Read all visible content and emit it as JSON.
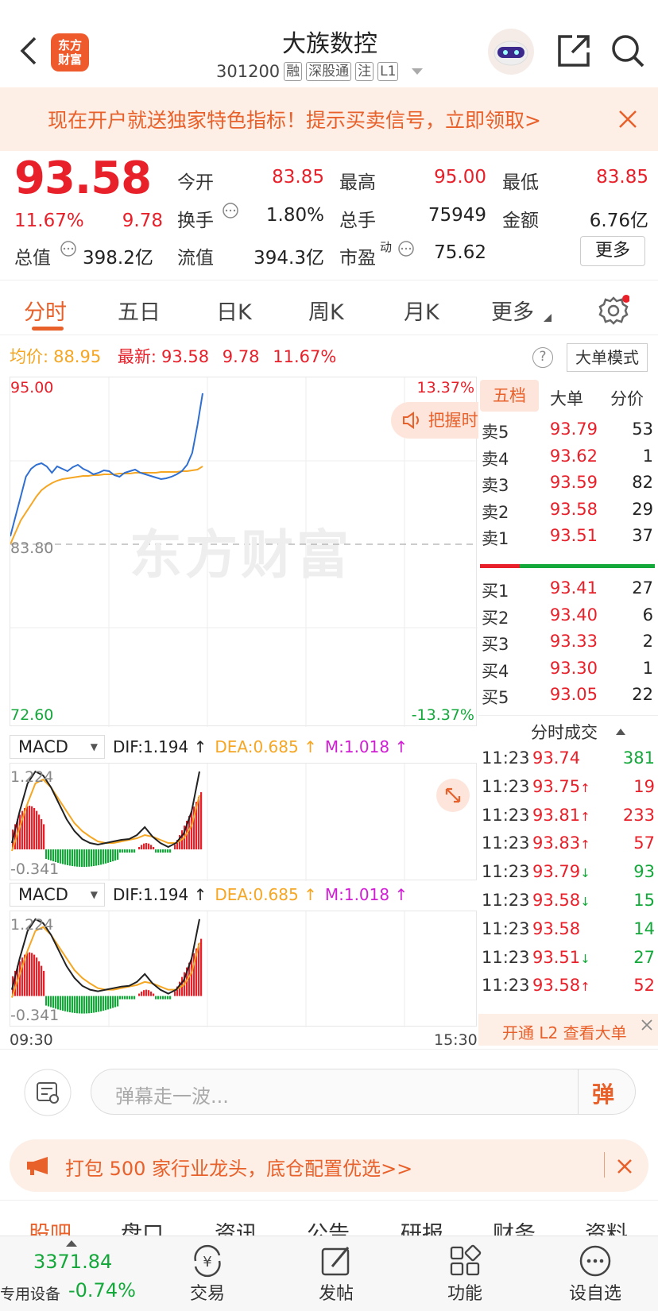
{
  "header": {
    "logo_text": "东方\n财富",
    "title": "大族数控",
    "code": "301200",
    "tags": [
      "融",
      "深股通",
      "注",
      "L1"
    ]
  },
  "banner": {
    "text": "现在开户就送独家特色指标！提示买卖信号，立即领取>"
  },
  "quote": {
    "price": "93.58",
    "change_pct": "11.67%",
    "change": "9.78",
    "open_label": "今开",
    "open": "83.85",
    "high_label": "最高",
    "high": "95.00",
    "low_label": "最低",
    "low": "83.85",
    "turnover_label": "换手",
    "turnover": "1.80%",
    "volume_label": "总手",
    "volume": "75949",
    "amount_label": "金额",
    "amount": "6.76亿",
    "mktcap_label": "总值",
    "mktcap": "398.2亿",
    "float_label": "流值",
    "float": "394.3亿",
    "pe_label": "市盈",
    "pe_sup": "动",
    "pe": "75.62",
    "more_label": "更多"
  },
  "tabs": [
    "分时",
    "五日",
    "日K",
    "周K",
    "月K",
    "更多"
  ],
  "chart_info": {
    "avg_label": "均价:",
    "avg": "88.95",
    "latest_label": "最新:",
    "latest": "93.58",
    "chg": "9.78",
    "pct": "11.67%",
    "big_order_label": "大单模式"
  },
  "chart_axis": {
    "top": "95.00",
    "top_pct": "13.37%",
    "mid": "83.80",
    "bottom": "72.60",
    "bottom_pct": "-13.37%",
    "start_time": "09:30",
    "end_time": "15:30",
    "watermark": "东方财富",
    "pill": "把握时"
  },
  "macd": {
    "name": "MACD",
    "dif": "DIF:1.194 ↑",
    "dea": "DEA:0.685 ↑",
    "m": "M:1.018 ↑",
    "top": "1.224",
    "bottom": "-0.341"
  },
  "right": {
    "tabs": [
      "五档",
      "大单",
      "分价"
    ],
    "asks": [
      {
        "l": "卖5",
        "p": "93.79",
        "v": "53"
      },
      {
        "l": "卖4",
        "p": "93.62",
        "v": "1"
      },
      {
        "l": "卖3",
        "p": "93.59",
        "v": "82"
      },
      {
        "l": "卖2",
        "p": "93.58",
        "v": "29"
      },
      {
        "l": "卖1",
        "p": "93.51",
        "v": "37"
      }
    ],
    "bids": [
      {
        "l": "买1",
        "p": "93.41",
        "v": "27"
      },
      {
        "l": "买2",
        "p": "93.40",
        "v": "6"
      },
      {
        "l": "买3",
        "p": "93.33",
        "v": "2"
      },
      {
        "l": "买4",
        "p": "93.30",
        "v": "1"
      },
      {
        "l": "买5",
        "p": "93.05",
        "v": "22"
      }
    ],
    "trades_title": "分时成交",
    "trades": [
      {
        "t": "11:23",
        "p": "93.74",
        "d": "",
        "v": "381",
        "vc": "green"
      },
      {
        "t": "11:23",
        "p": "93.75",
        "d": "↑",
        "v": "19",
        "vc": "red"
      },
      {
        "t": "11:23",
        "p": "93.81",
        "d": "↑",
        "v": "233",
        "vc": "red"
      },
      {
        "t": "11:23",
        "p": "93.83",
        "d": "↑",
        "v": "57",
        "vc": "red"
      },
      {
        "t": "11:23",
        "p": "93.79",
        "d": "↓",
        "v": "93",
        "vc": "green"
      },
      {
        "t": "11:23",
        "p": "93.58",
        "d": "↓",
        "v": "15",
        "vc": "green"
      },
      {
        "t": "11:23",
        "p": "93.58",
        "d": "",
        "v": "14",
        "vc": "green"
      },
      {
        "t": "11:23",
        "p": "93.51",
        "d": "↓",
        "v": "27",
        "vc": "green"
      },
      {
        "t": "11:23",
        "p": "93.58",
        "d": "↑",
        "v": "52",
        "vc": "red"
      }
    ],
    "l2_text": "开通 L2 查看大单"
  },
  "comment": {
    "placeholder": "弹幕走一波...",
    "send": "弹"
  },
  "promo": {
    "text": "打包 500 家行业龙头，底仓配置优选>>"
  },
  "subtabs": [
    "股吧",
    "盘口",
    "资讯",
    "公告",
    "研报",
    "财务",
    "资料"
  ],
  "nav": {
    "index_value": "3371.84",
    "device_label": "专用设备",
    "index_pct": "-0.74%",
    "items": [
      "交易",
      "发帖",
      "功能",
      "设自选"
    ]
  },
  "colors": {
    "red": "#e8202a",
    "green": "#14a83b",
    "orange": "#e8602a",
    "avg_line": "#f5a623",
    "price_line": "#2f6fd1"
  }
}
